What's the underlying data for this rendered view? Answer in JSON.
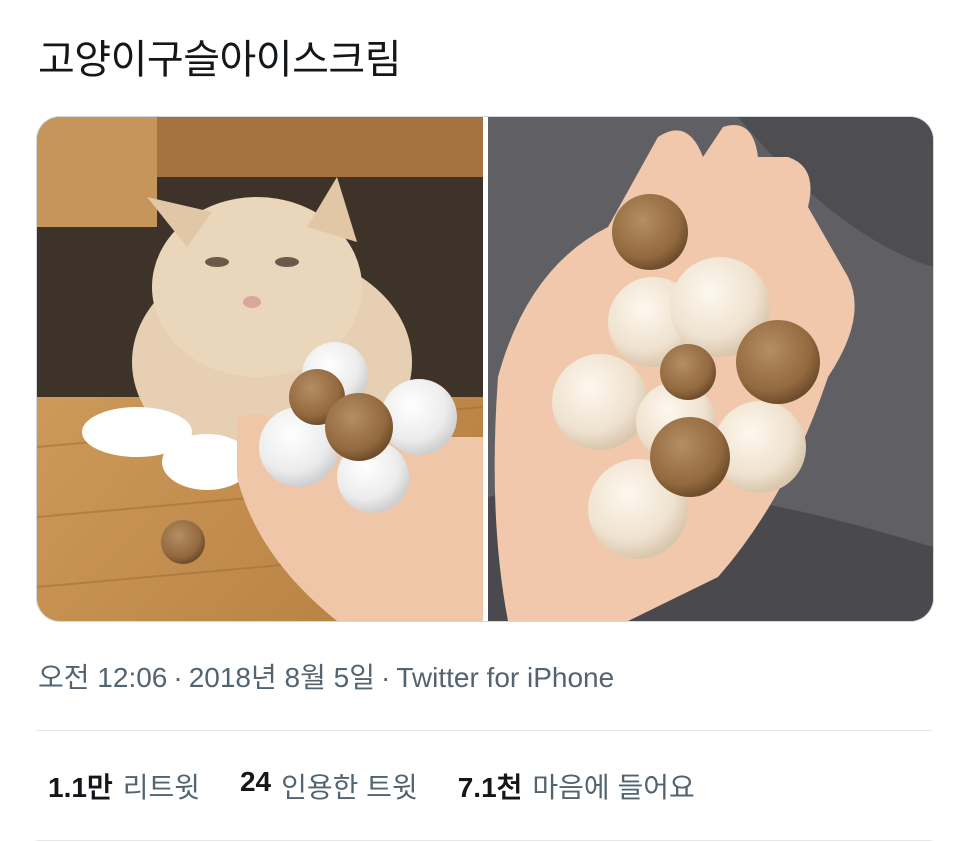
{
  "tweet": {
    "text": "고양이구슬아이스크림",
    "time": "오전 12:06",
    "date": "2018년 8월 5일",
    "source": "Twitter for iPhone",
    "separator": "·"
  },
  "stats": [
    {
      "count": "1.1만",
      "label": "리트윗"
    },
    {
      "count": "24",
      "label": "인용한 트윗"
    },
    {
      "count": "7.1천",
      "label": "마음에 들어요"
    }
  ],
  "colors": {
    "text": "#14171a",
    "secondary": "#536471",
    "border": "#cfd9de",
    "divider": "#e1e8ed"
  }
}
